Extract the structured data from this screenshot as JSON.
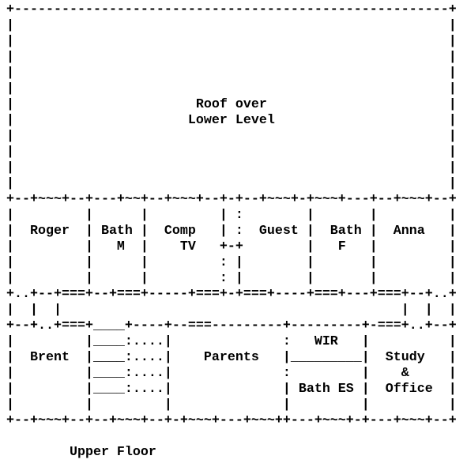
{
  "title": "Upper Floor",
  "rooms": [
    "Roof over Lower Level",
    "Roger",
    "Bath M",
    "Comp TV",
    "Guest",
    "Bath F",
    "Anna",
    "Brent",
    "Parents",
    "WIR",
    "Bath ES",
    "Study & Office"
  ],
  "lines": [
    "+-------------------------------------------------------+",
    "|                                                       |",
    "|                                                       |",
    "|                                                       |",
    "|                                                       |",
    "|                                                       |",
    "|                       Roof over                       |",
    "|                      Lower Level                      |",
    "|                                                       |",
    "|                                                       |",
    "|                                                       |",
    "|                                                       |",
    "+--+~~~+--+---+~~+--+~~~+--+-+--+~~~+-+~~~+---+--+~~~+--+",
    "|         |      |         | :        |       |         |",
    "|  Roger  | Bath |  Comp   | :  Guest |  Bath |  Anna   |",
    "|         |   M  |    TV   +-+        |   F   |         |",
    "|         |      |         : |        |       |         |",
    "|         |      |         : |        |       |         |",
    "+..+--+===+--+===+-----+===+-+===+----+===+---+===+--+..+",
    "|  |  |                                           |  |  |",
    "+--+..+===+____+----+--===---------+---------+-===+..+--+",
    "|         |____:....|              :   WIR   |          |",
    "|  Brent  |____:....|    Parents   |_________|  Study   |",
    "|         |____:....|              :         |    &     |",
    "|         |____:....|              | Bath ES |  Office  |",
    "|         |         |              |         |          |",
    "+--+~~~+--+--+~~~+--+-+~~~+---+~~~++---+~~~+-+---+~~~+--+",
    "",
    "        Upper Floor"
  ]
}
